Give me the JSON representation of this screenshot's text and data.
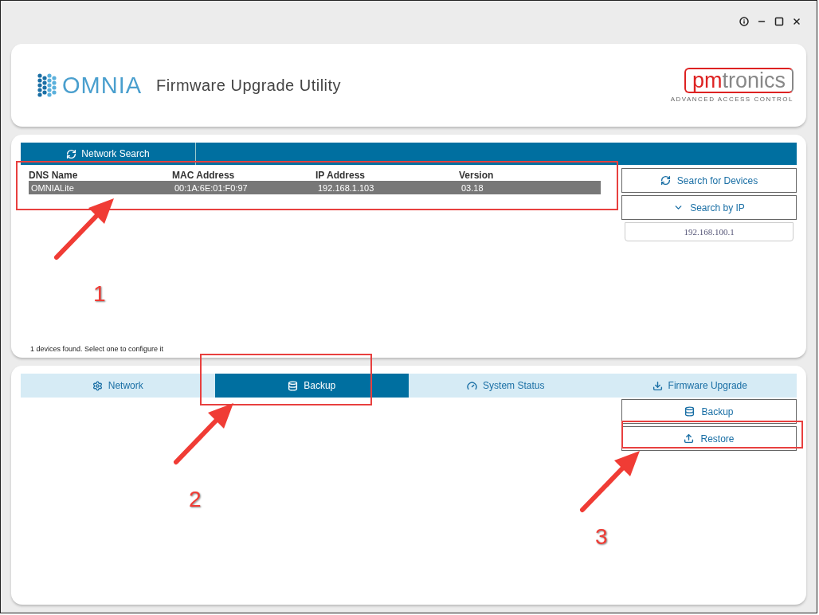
{
  "header": {
    "product_logo": "OMNIA",
    "title": "Firmware Upgrade Utility",
    "company_logo": {
      "brand_a": "pm",
      "brand_b": "tronics",
      "tagline": "ADVANCED ACCESS CONTROL"
    }
  },
  "network_search": {
    "tab": "Network Search",
    "table": {
      "columns": [
        "DNS Name",
        "MAC Address",
        "IP Address",
        "Version"
      ],
      "rows": [
        {
          "cells": [
            "OMNIALite",
            "00:1A:6E:01:F0:97",
            "192.168.1.103",
            "03.18"
          ],
          "selected": true
        }
      ]
    },
    "buttons": [
      {
        "label": "Search for Devices"
      },
      {
        "label": "Search by IP"
      }
    ],
    "ip_field": {
      "value": "192.168.100.1"
    },
    "status": "1 devices found. Select one to configure it"
  },
  "config": {
    "tabs": [
      {
        "label": "Network",
        "selected": false
      },
      {
        "label": "Backup",
        "selected": true
      },
      {
        "label": "System Status",
        "selected": false
      },
      {
        "label": "Firmware Upgrade",
        "selected": false
      }
    ],
    "actions": [
      {
        "label": "Backup"
      },
      {
        "label": "Restore"
      }
    ]
  },
  "annotations": [
    {
      "label": "1"
    },
    {
      "label": "2"
    },
    {
      "label": "3"
    }
  ]
}
